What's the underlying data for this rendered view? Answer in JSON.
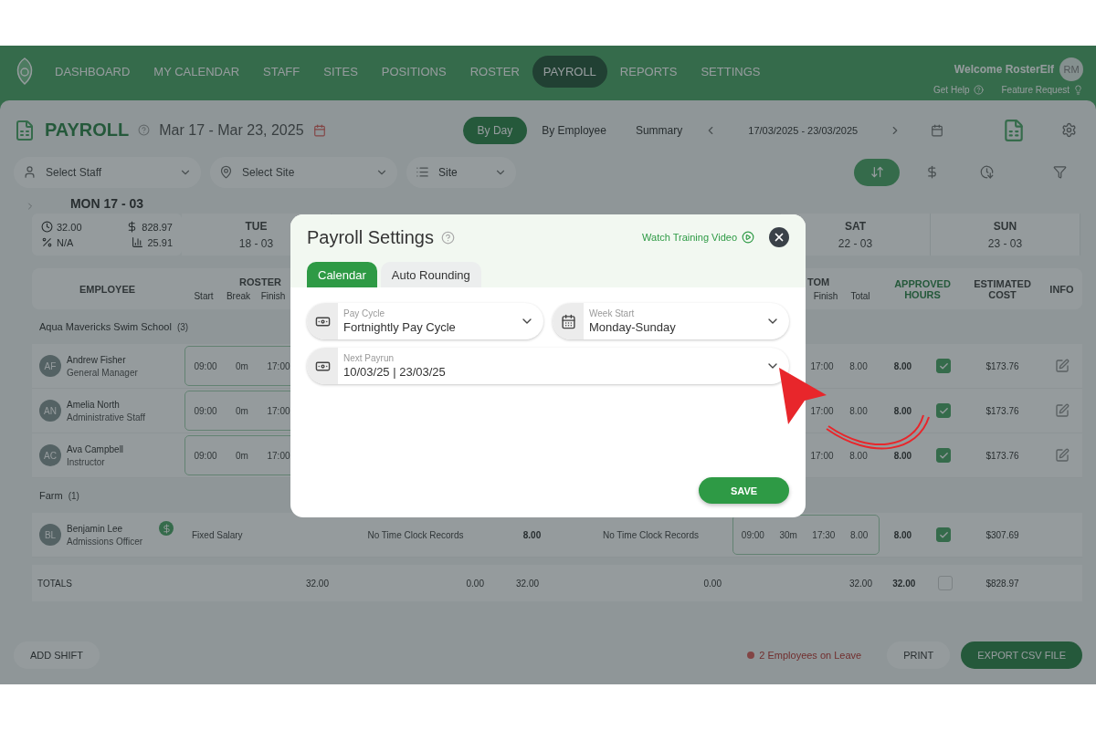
{
  "nav": {
    "items": [
      {
        "label": "DASHBOARD",
        "selected": false
      },
      {
        "label": "MY CALENDAR",
        "selected": false
      },
      {
        "label": "STAFF",
        "selected": false
      },
      {
        "label": "SITES",
        "selected": false
      },
      {
        "label": "POSITIONS",
        "selected": false
      },
      {
        "label": "ROSTER",
        "selected": false
      },
      {
        "label": "PAYROLL",
        "selected": true
      },
      {
        "label": "REPORTS",
        "selected": false
      },
      {
        "label": "SETTINGS",
        "selected": false
      }
    ],
    "welcome": "Welcome RosterElf",
    "avatar": "RM",
    "links": [
      {
        "kind": "help",
        "label": "Get Help"
      },
      {
        "kind": "idea",
        "label": "Feature Request"
      }
    ]
  },
  "header": {
    "title": "PAYROLL",
    "date_range": "Mar 17 - Mar 23, 2025",
    "views": [
      {
        "label": "By Day",
        "selected": true
      },
      {
        "label": "By Employee",
        "selected": false
      },
      {
        "label": "Summary",
        "selected": false
      }
    ],
    "period": "17/03/2025 - 23/03/2025"
  },
  "filters": {
    "staff": {
      "placeholder": "Select Staff"
    },
    "site": {
      "placeholder": "Select Site"
    },
    "group_by": "Site"
  },
  "days_start": [
    {
      "kind": "expanded",
      "day": "MON 17 - 03",
      "stats": [
        {
          "kind": "hours",
          "value": "32.00"
        },
        {
          "kind": "cost",
          "value": "828.97"
        },
        {
          "kind": "percent",
          "value": "N/A"
        },
        {
          "kind": "average",
          "value": "25.91"
        }
      ]
    },
    {
      "kind": "day",
      "day": "TUE",
      "date": "18 - 03"
    }
  ],
  "days_end": [
    {
      "kind": "day",
      "day": "SAT",
      "date": "22 - 03"
    },
    {
      "kind": "day",
      "day": "SUN",
      "date": "23 - 03"
    }
  ],
  "table": {
    "columns": [
      {
        "label": "EMPLOYEE"
      },
      {
        "label": "ROSTER",
        "sub": [
          "Start",
          "Break",
          "Finish"
        ]
      },
      {
        "label": "TOM",
        "sub": [
          "Finish",
          "Total"
        ]
      },
      {
        "label": "APPROVED HOURS"
      },
      {
        "label": "ESTIMATED COST"
      },
      {
        "label": "INFO"
      }
    ],
    "groups": [
      {
        "name": "Aqua Mavericks Swim School",
        "count": "(3)",
        "rows": [
          {
            "kind": "shift",
            "initials": "AF",
            "name": "Andrew Fisher",
            "role": "General Manager",
            "salary_badge": false,
            "roster": [
              "09:00",
              "0m",
              "17:00"
            ],
            "custom": [
              "17:00",
              "8.00"
            ],
            "approved": "8.00",
            "approved_checked": true,
            "cost": "$173.76",
            "info": true
          },
          {
            "kind": "shift",
            "initials": "AN",
            "name": "Amelia North",
            "role": "Administrative Staff",
            "salary_badge": false,
            "roster": [
              "09:00",
              "0m",
              "17:00"
            ],
            "custom": [
              "17:00",
              "8.00"
            ],
            "approved": "8.00",
            "approved_checked": true,
            "cost": "$173.76",
            "info": true
          },
          {
            "kind": "shift",
            "initials": "AC",
            "name": "Ava Campbell",
            "role": "Instructor",
            "salary_badge": false,
            "roster": [
              "09:00",
              "0m",
              "17:00"
            ],
            "custom": [
              "17:00",
              "8.00"
            ],
            "approved": "8.00",
            "approved_checked": true,
            "cost": "$173.76",
            "info": true
          }
        ]
      },
      {
        "name": "Farm",
        "count": "(1)",
        "rows": [
          {
            "kind": "salary",
            "initials": "BL",
            "name": "Benjamin Lee",
            "role": "Admissions Officer",
            "salary_badge": true,
            "roster_note": "Fixed Salary",
            "clock_note": "No Time Clock Records",
            "hours": "8.00",
            "clock_note_2": "No Time Clock Records",
            "custom": [
              "09:00",
              "30m",
              "17:30",
              "8.00"
            ],
            "approved": "8.00",
            "approved_checked": true,
            "cost": "$307.69",
            "info": false
          }
        ]
      }
    ],
    "totals": {
      "label": "TOTALS",
      "roster": "32.00",
      "clock": "0.00",
      "hours": "32.00",
      "clock_2": "0.00",
      "custom": "32.00",
      "approved": "32.00",
      "approved_checked": false,
      "cost": "$828.97"
    }
  },
  "footer": {
    "add": "ADD SHIFT",
    "leave": "2 Employees on Leave",
    "print": "PRINT",
    "export": "EXPORT CSV FILE"
  },
  "modal": {
    "title": "Payroll Settings",
    "video_link": "Watch Training Video",
    "tabs": [
      {
        "label": "Calendar",
        "selected": true
      },
      {
        "label": "Auto Rounding",
        "selected": false
      }
    ],
    "fields": [
      {
        "kind": "pay",
        "label": "Pay Cycle",
        "value": "Fortnightly Pay Cycle"
      },
      {
        "kind": "calendar",
        "label": "Week Start",
        "value": "Monday-Sunday"
      },
      {
        "kind": "pay",
        "label": "Next Payrun",
        "value": "10/03/25 | 23/03/25"
      }
    ],
    "save": "SAVE"
  }
}
